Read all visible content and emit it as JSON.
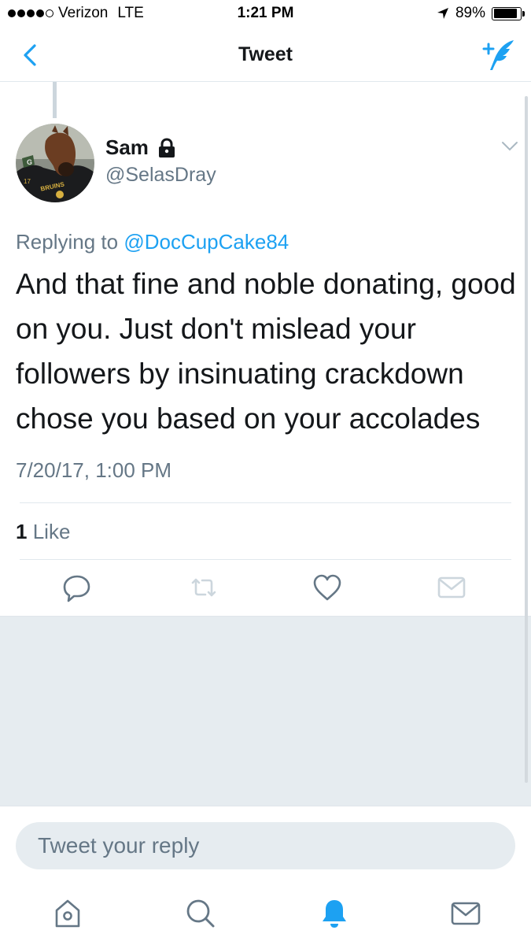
{
  "status_bar": {
    "carrier": "Verizon",
    "network": "LTE",
    "time": "1:21 PM",
    "battery_percent": "89%",
    "battery_level": 0.89,
    "signal_bars_filled": 4,
    "signal_bars_total": 5
  },
  "nav": {
    "back_icon": "chevron-left-icon",
    "title": "Tweet",
    "compose_icon": "compose-tweet-icon"
  },
  "tweet": {
    "author_name": "Sam",
    "protected_icon": "lock-icon",
    "author_handle": "@SelasDray",
    "replying_prefix": "Replying to",
    "replying_handle": "@DocCupCake84",
    "text": "And that fine and noble donating, good on you. Just don't mislead your followers by insinuating crackdown chose you based on your accolades",
    "timestamp": "7/20/17, 1:00 PM",
    "like_count": "1",
    "like_label": "Like",
    "actions": [
      "reply-icon",
      "retweet-icon",
      "heart-icon",
      "direct-message-icon"
    ]
  },
  "reply_bar": {
    "placeholder": "Tweet your reply"
  },
  "tab_bar": {
    "tabs": [
      "home-icon",
      "search-icon",
      "notifications-icon",
      "messages-icon"
    ],
    "active_tab": "notifications-icon"
  },
  "colors": {
    "accent": "#1da1f2",
    "text_primary": "#14171a",
    "text_secondary": "#657786",
    "background_gray": "#e6ecf0",
    "divider": "#e1e8ed"
  }
}
